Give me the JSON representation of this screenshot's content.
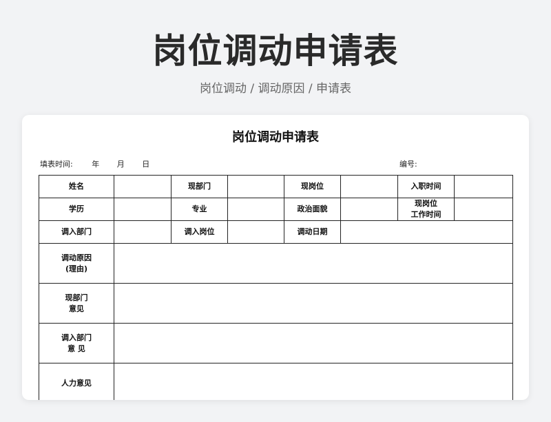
{
  "page": {
    "title": "岗位调动申请表",
    "subtitle": "岗位调动 / 调动原因 / 申请表"
  },
  "form": {
    "title": "岗位调动申请表",
    "fill_time_label": "填表时间:",
    "year_label": "年",
    "month_label": "月",
    "day_label": "日",
    "number_label": "编号:",
    "rows": {
      "name": "姓名",
      "current_dept": "现部门",
      "current_position": "现岗位",
      "entry_time": "入职时间",
      "education": "学历",
      "major": "专业",
      "political_status": "政治面貌",
      "position_work_time_line1": "现岗位",
      "position_work_time_line2": "工作时间",
      "transfer_dept": "调入部门",
      "transfer_position": "调入岗位",
      "transfer_date": "调动日期",
      "reason_line1": "调动原因",
      "reason_line2": "(理由)",
      "current_dept_opinion_line1": "现部门",
      "current_dept_opinion_line2": "意见",
      "transfer_dept_opinion_line1": "调入部门",
      "transfer_dept_opinion_line2": "意 见",
      "hr_opinion": "人力意见"
    }
  }
}
